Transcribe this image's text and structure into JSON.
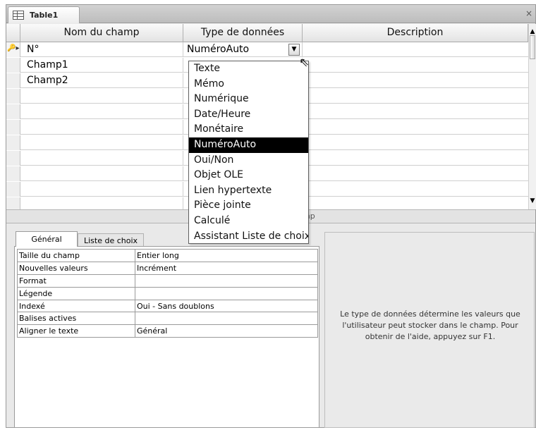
{
  "window": {
    "tab_title": "Table1",
    "close_glyph": "×"
  },
  "grid": {
    "headers": {
      "name": "Nom du champ",
      "type": "Type de données",
      "description": "Description"
    },
    "rows": [
      {
        "name": "N°",
        "type": "NuméroAuto",
        "description": "",
        "primary_key": true
      },
      {
        "name": "Champ1",
        "type": "",
        "description": ""
      },
      {
        "name": "Champ2",
        "type": "",
        "description": ""
      }
    ],
    "empty_row_count": 8,
    "primary_key_icon": "key-icon"
  },
  "dropdown": {
    "options": [
      "Texte",
      "Mémo",
      "Numérique",
      "Date/Heure",
      "Monétaire",
      "NuméroAuto",
      "Oui/Non",
      "Objet OLE",
      "Lien hypertexte",
      "Pièce jointe",
      "Calculé",
      "Assistant Liste de choix..."
    ],
    "selected": "NuméroAuto"
  },
  "properties_caption": "mp",
  "property_tabs": {
    "general": "Général",
    "lookup": "Liste de choix"
  },
  "properties": [
    {
      "name": "Taille du champ",
      "value": "Entier long"
    },
    {
      "name": "Nouvelles valeurs",
      "value": "Incrément"
    },
    {
      "name": "Format",
      "value": ""
    },
    {
      "name": "Légende",
      "value": ""
    },
    {
      "name": "Indexé",
      "value": "Oui - Sans doublons"
    },
    {
      "name": "Balises actives",
      "value": ""
    },
    {
      "name": "Aligner le texte",
      "value": "Général"
    }
  ],
  "help_text": "Le type de données détermine les valeurs que l'utilisateur peut stocker dans le champ. Pour obtenir de l'aide, appuyez sur F1.",
  "colors": {
    "selected_option_bg": "#000000",
    "help_bg": "#eaeaea",
    "frame_bg": "#e9e9e9"
  }
}
